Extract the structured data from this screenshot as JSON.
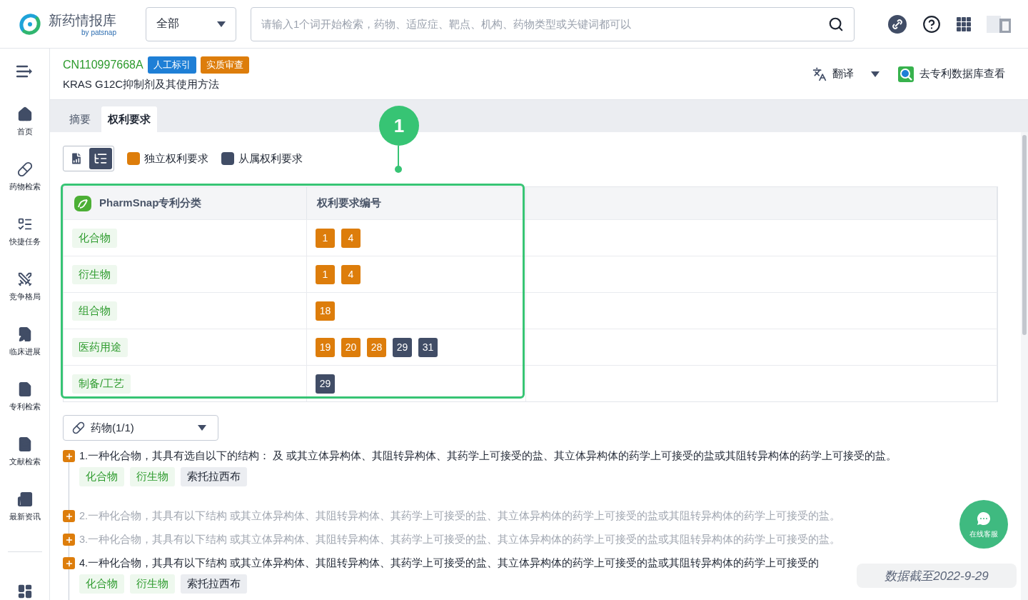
{
  "header": {
    "logo_title": "新药情报库",
    "logo_byline": "by patsnap",
    "scope_select": {
      "value": "全部"
    },
    "search": {
      "placeholder": "请输入1个词开始检索，药物、适应症、靶点、机构、药物类型或关键词都可以"
    }
  },
  "sidebar": {
    "items": [
      {
        "label": "首页",
        "selected": false
      },
      {
        "label": "药物检索",
        "selected": false
      },
      {
        "label": "快捷任务",
        "selected": false
      },
      {
        "label": "竞争格局",
        "selected": false
      },
      {
        "label": "临床进展",
        "selected": false
      },
      {
        "label": "专利检索",
        "selected": false
      },
      {
        "label": "文献检索",
        "selected": false
      },
      {
        "label": "最新资讯",
        "selected": false
      }
    ]
  },
  "patent": {
    "number": "CN110997668A",
    "badges": [
      {
        "label": "人工标引",
        "color": "#1e7fd6"
      },
      {
        "label": "实质审查",
        "color": "#dd7d0b"
      }
    ],
    "title": "KRAS G12C抑制剂及其使用方法",
    "actions": [
      {
        "label": "翻译",
        "kind": "dropdown"
      },
      {
        "label": "去专利数据库查看",
        "kind": "link"
      }
    ]
  },
  "tabs": [
    {
      "label": "摘要",
      "selected": false
    },
    {
      "label": "权利要求",
      "selected": true
    }
  ],
  "view_toggle": [
    {
      "selected": false
    },
    {
      "selected": true
    }
  ],
  "legend": [
    {
      "label": "独立权利要求",
      "color": "#dd7d0b"
    },
    {
      "label": "从属权利要求",
      "color": "#414d66"
    }
  ],
  "callout": {
    "label": "1"
  },
  "table": {
    "columns": [
      "PharmSnap专利分类",
      "权利要求编号"
    ],
    "rows": [
      {
        "category": "化合物",
        "claims": [
          {
            "label": "1",
            "kind": "independent"
          },
          {
            "label": "4",
            "kind": "independent"
          }
        ]
      },
      {
        "category": "衍生物",
        "claims": [
          {
            "label": "1",
            "kind": "independent"
          },
          {
            "label": "4",
            "kind": "independent"
          }
        ]
      },
      {
        "category": "组合物",
        "claims": [
          {
            "label": "18",
            "kind": "independent"
          }
        ]
      },
      {
        "category": "医药用途",
        "claims": [
          {
            "label": "19",
            "kind": "independent"
          },
          {
            "label": "20",
            "kind": "independent"
          },
          {
            "label": "28",
            "kind": "independent"
          },
          {
            "label": "29",
            "kind": "dependent"
          },
          {
            "label": "31",
            "kind": "dependent"
          }
        ]
      },
      {
        "category": "制备/工艺",
        "claims": [
          {
            "label": "29",
            "kind": "dependent"
          }
        ]
      }
    ]
  },
  "filter_select": {
    "value": "药物(1/1)"
  },
  "claims": [
    {
      "text": "1.一种化合物，其具有选自以下的结构： 及 或其立体异构体、其阻转异构体、其药学上可接受的盐、其立体异构体的药学上可接受的盐或其阻转异构体的药学上可接受的盐。",
      "highlighted": true,
      "tags": [
        {
          "label": "化合物",
          "kind": "category"
        },
        {
          "label": "衍生物",
          "kind": "category"
        },
        {
          "label": "索托拉西布",
          "kind": "drug"
        }
      ]
    },
    {
      "text": "2.一种化合物，其具有以下结构 或其立体异构体、其阻转异构体、其药学上可接受的盐、其立体异构体的药学上可接受的盐或其阻转异构体的药学上可接受的盐。",
      "highlighted": false
    },
    {
      "text": "3.一种化合物，其具有以下结构 或其立体异构体、其阻转异构体、其药学上可接受的盐、其立体异构体的药学上可接受的盐或其阻转异构体的药学上可接受的盐。",
      "highlighted": false
    },
    {
      "text": "4.一种化合物，其具有以下结构 或其立体异构体、其阻转异构体、其药学上可接受的盐、其立体异构体的药学上可接受的盐或其阻转异构体的药学上可接受的",
      "highlighted": true,
      "tags": [
        {
          "label": "化合物",
          "kind": "category"
        },
        {
          "label": "衍生物",
          "kind": "category"
        },
        {
          "label": "索托拉西布",
          "kind": "drug"
        }
      ]
    }
  ],
  "chat_button": {
    "label": "在线客服"
  },
  "data_note": "数据截至2022-9-29"
}
